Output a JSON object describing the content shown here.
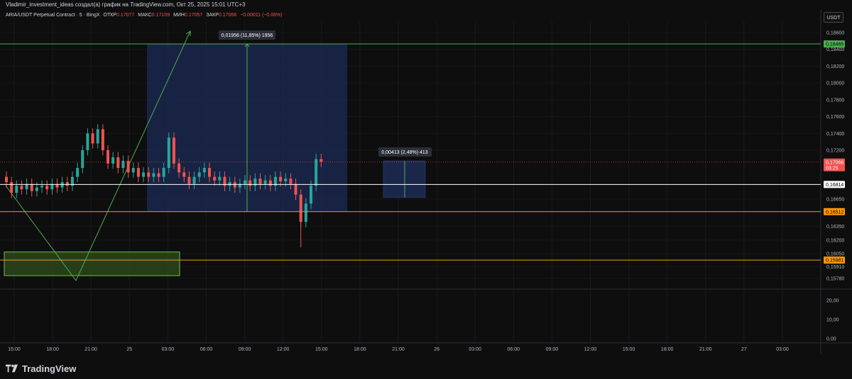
{
  "header": {
    "author_line": "Vladimir_investment_ideas создал(а) график на TradingView.com, Окт 25, 2025 15:01 UTC+3"
  },
  "legend": {
    "symbol": "ARIA/USDT Perpetual Contract · 5 · BingX",
    "open_label": "ОТКР",
    "open_value": "0.17077",
    "high_label": "МАКС",
    "high_value": "0.17109",
    "low_label": "МИН",
    "low_value": "0.17057",
    "close_label": "ЗАКР",
    "close_value": "0.17066",
    "change": "−0.00011 (−0.06%)"
  },
  "currency": "USDT",
  "colors": {
    "background": "#0e0e0e",
    "up": "#26a69a",
    "down": "#ef5350",
    "green_line": "#4caf50",
    "orange_line": "#ff9800",
    "white_line": "#ffffff",
    "range_box": "#1c2b55",
    "zone_box": "#2f4d1f"
  },
  "chart_data": {
    "type": "candlestick",
    "price_axis_ticks": [
      "0,18600",
      "0,18400",
      "0,18200",
      "0,18000",
      "0,17800",
      "0,17600",
      "0,17400",
      "0,17200",
      "0,16650",
      "0,16350",
      "0,16200",
      "0,16050",
      "0,15910",
      "0,15780"
    ],
    "price_axis_values": [
      0.186,
      0.184,
      0.182,
      0.18,
      0.178,
      0.176,
      0.174,
      0.172,
      0.1665,
      0.1635,
      0.162,
      0.1605,
      0.1591,
      0.1578
    ],
    "volume_axis_ticks": [
      "20,00",
      "10,00",
      "0,00"
    ],
    "time_axis_ticks": [
      "15:00",
      "18:00",
      "21:00",
      "25",
      "03:00",
      "06:00",
      "09:00",
      "12:00",
      "15:00",
      "18:00",
      "21:00",
      "26",
      "03:00",
      "06:00",
      "09:00",
      "12:00",
      "15:00",
      "18:00",
      "21:00",
      "27",
      "03:00"
    ],
    "price_labels": [
      {
        "value": "0,18465",
        "kind": "green"
      },
      {
        "value": "0,17066",
        "kind": "current",
        "countdown": "03:25"
      },
      {
        "value": "0,16814",
        "kind": "white"
      },
      {
        "value": "0,16512",
        "kind": "orange"
      },
      {
        "value": "0,15981",
        "kind": "orange"
      }
    ],
    "horizontal_levels": {
      "green": 0.18465,
      "current": 0.17066,
      "white": 0.16814,
      "orange_1": 0.16512,
      "orange_2": 0.15981
    },
    "range_measure": {
      "label": "0,01956 (11,85%) 1956",
      "top": 0.18465,
      "bottom": 0.16512
    },
    "small_measure": {
      "label": "0,00413 (2,48%) 413",
      "top": 0.1708,
      "bottom": 0.16667
    },
    "demand_zone": {
      "top": 0.1607,
      "bottom": 0.1581
    }
  }
}
